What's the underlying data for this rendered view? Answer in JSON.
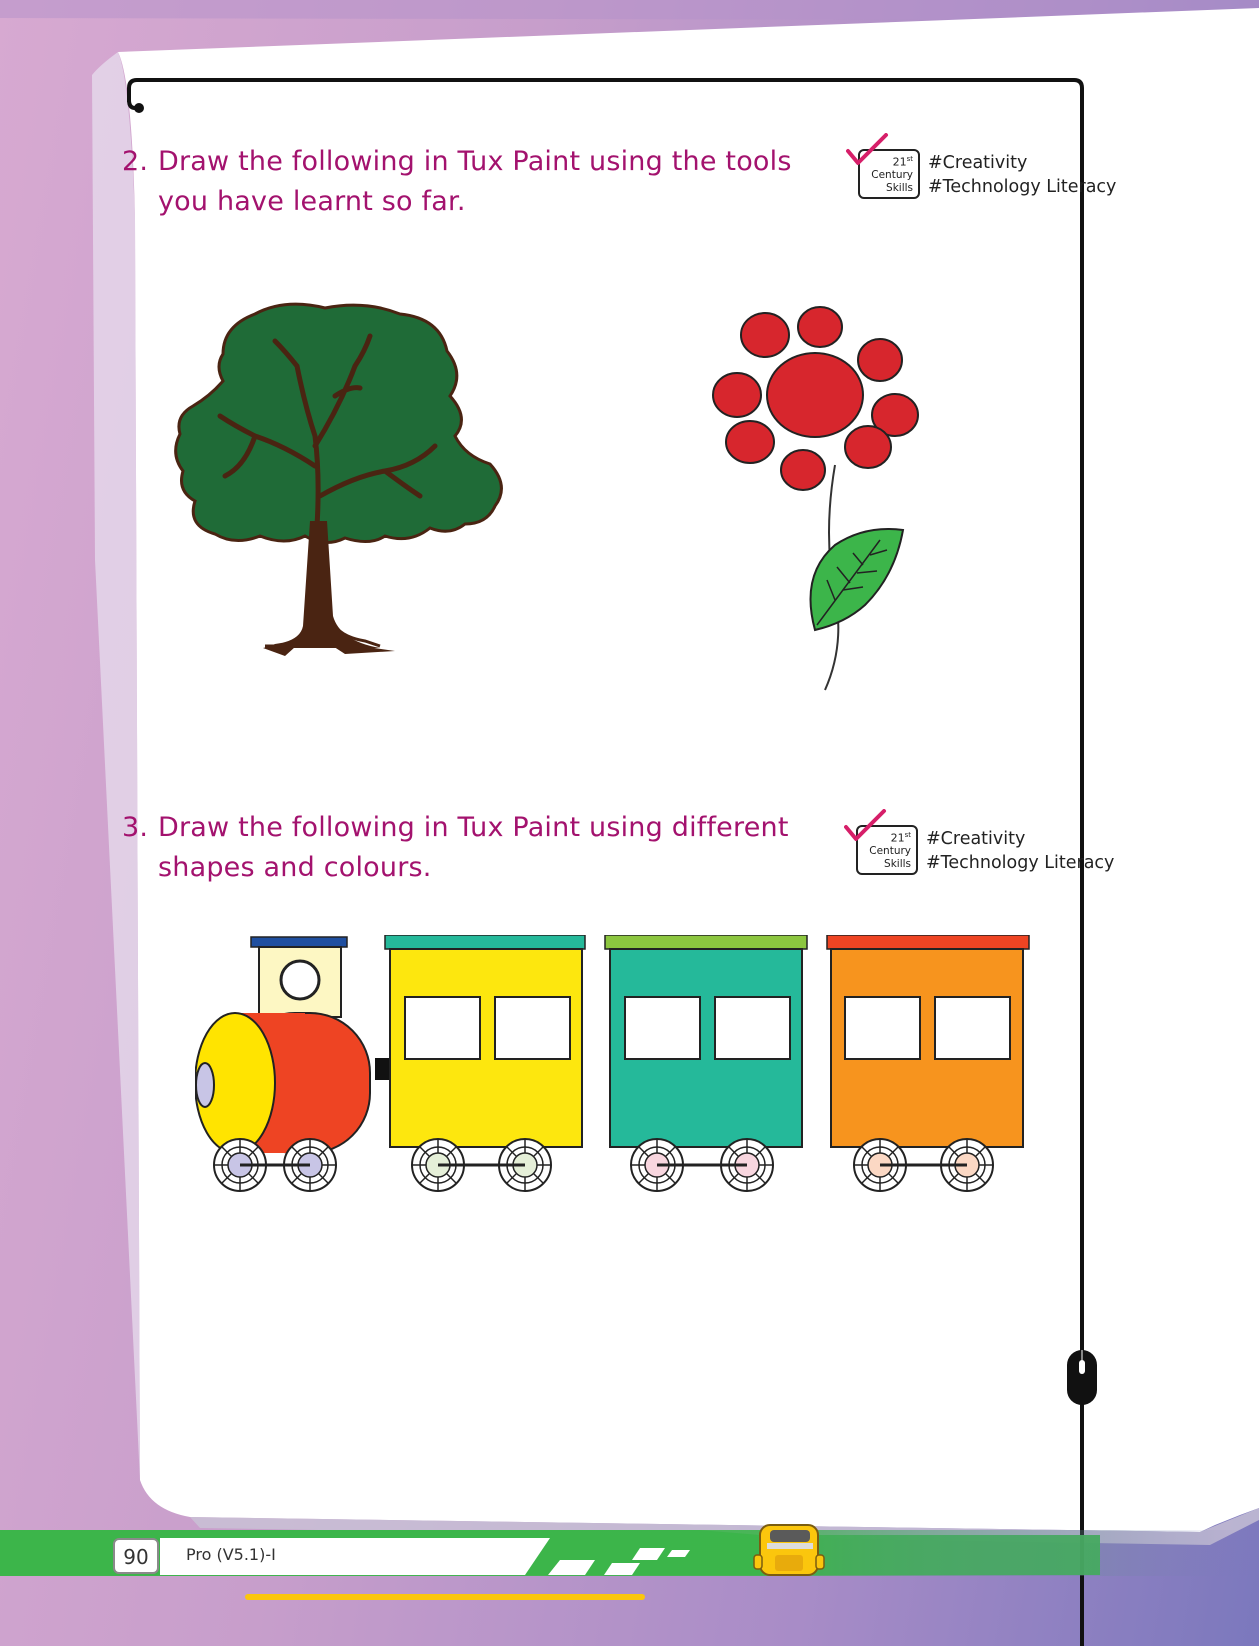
{
  "questions": [
    {
      "number": "2.",
      "line1": "Draw the following in Tux Paint using the tools",
      "line2": "you have learnt so far."
    },
    {
      "number": "3.",
      "line1": "Draw the following in Tux Paint using different",
      "line2": "shapes and colours."
    }
  ],
  "skills_badge": {
    "ordinal": "21",
    "suffix": "st",
    "century": "Century",
    "skills": "Skills",
    "tags": [
      "#Creativity",
      "#Technology Literacy"
    ]
  },
  "illustrations": [
    "tree-icon",
    "flower-icon",
    "train-icon"
  ],
  "footer": {
    "page_number": "90",
    "book_title": "Pro (V5.1)-I"
  },
  "colors": {
    "question_text": "#a3126e",
    "tree_leaves": "#1f6b37",
    "tree_trunk": "#4a2412",
    "flower_petals": "#d7262d",
    "leaf_green": "#3cb54a",
    "engine_red": "#ee4423",
    "engine_yellow": "#ffe400",
    "car1": "#fde70e",
    "car2": "#25b99a",
    "car3": "#f7941e",
    "footer_green": "#3cb54a"
  }
}
